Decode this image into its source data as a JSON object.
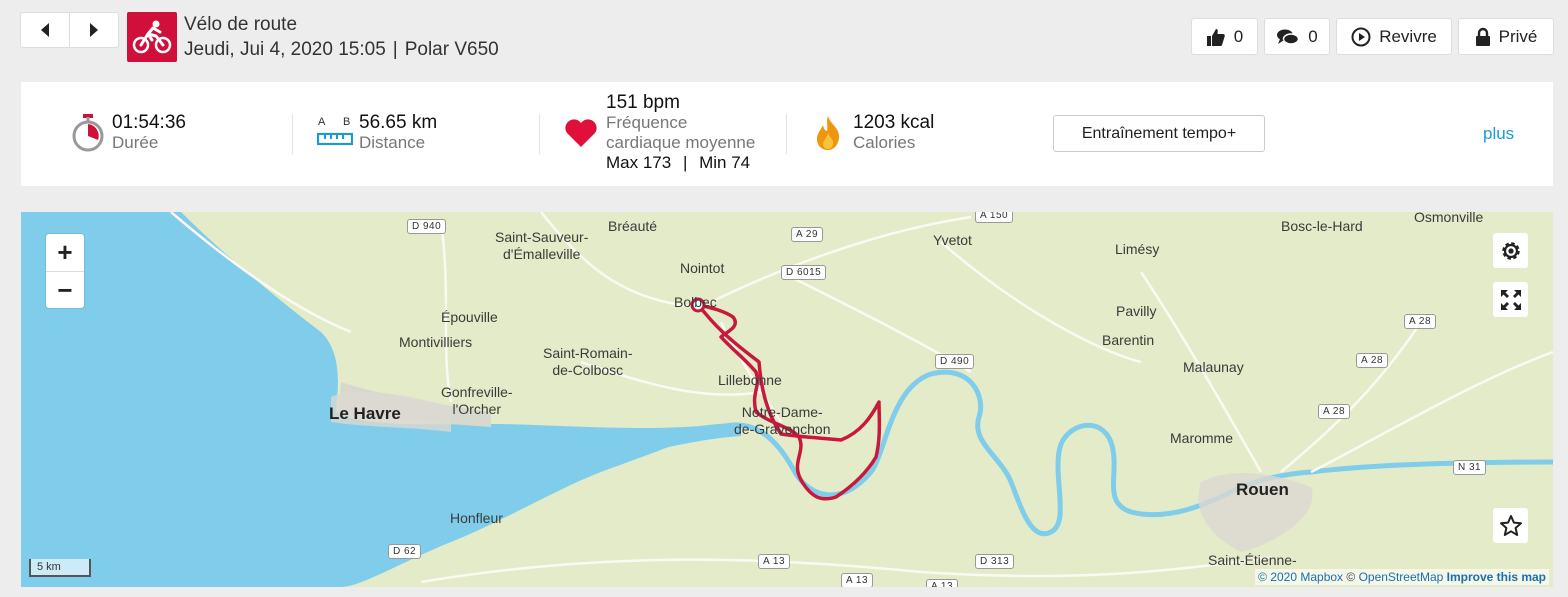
{
  "header": {
    "title": "Vélo de route",
    "date": "Jeudi, Jui 4, 2020 15:05",
    "separator": "|",
    "device": "Polar V650"
  },
  "actions": {
    "like_count": "0",
    "comment_count": "0",
    "relive_label": "Revivre",
    "private_label": "Privé"
  },
  "summary": {
    "duration": {
      "value": "01:54:36",
      "label": "Durée"
    },
    "distance": {
      "ab_a": "A",
      "ab_b": "B",
      "value": "56.65 km",
      "label": "Distance"
    },
    "heart_rate": {
      "value": "151 bpm",
      "label_line1": "Fréquence",
      "label_line2": "cardiaque moyenne",
      "max": "Max 173",
      "sep": "|",
      "min": "Min 74"
    },
    "calories": {
      "value": "1203 kcal",
      "label": "Calories"
    },
    "training_benefit": "Entraînement tempo+",
    "more_label": "plus"
  },
  "map": {
    "places": [
      {
        "name": "Bréauté"
      },
      {
        "name": "Saint-Sauveur-\nd'Émalleville"
      },
      {
        "name": "Yvetot"
      },
      {
        "name": "Limésy"
      },
      {
        "name": "Bosc-le-Hard"
      },
      {
        "name": "Osmonville"
      },
      {
        "name": "Nointot"
      },
      {
        "name": "Bolbec"
      },
      {
        "name": "Épouville"
      },
      {
        "name": "Montivilliers"
      },
      {
        "name": "Saint-Romain-\nde-Colbosc"
      },
      {
        "name": "Pavilly"
      },
      {
        "name": "Barentin"
      },
      {
        "name": "Malaunay"
      },
      {
        "name": "Lillebonne"
      },
      {
        "name": "Gonfreville-\nl'Orcher"
      },
      {
        "name": "Le Havre",
        "big": true
      },
      {
        "name": "Notre-Dame-\nde-Gravenchon"
      },
      {
        "name": "Maromme"
      },
      {
        "name": "Rouen",
        "big": true
      },
      {
        "name": "Honfleur"
      },
      {
        "name": "Saint-Étienne-"
      }
    ],
    "roads": [
      "D 940",
      "A 29",
      "A 150",
      "D 6015",
      "D 490",
      "A 28",
      "A 28",
      "A 28",
      "N 31",
      "D 62",
      "A 13",
      "D 313",
      "A 13",
      "A 13"
    ],
    "zoom_in": "+",
    "zoom_out": "−",
    "scale_label": "5 km",
    "attribution": {
      "mapbox": "© 2020 Mapbox",
      "osm_prefix": "©",
      "osm": "OpenStreetMap",
      "improve": "Improve this map"
    },
    "colors": {
      "land": "#e4ebc9",
      "water": "#7fcdea",
      "route": "#c8193d"
    }
  }
}
